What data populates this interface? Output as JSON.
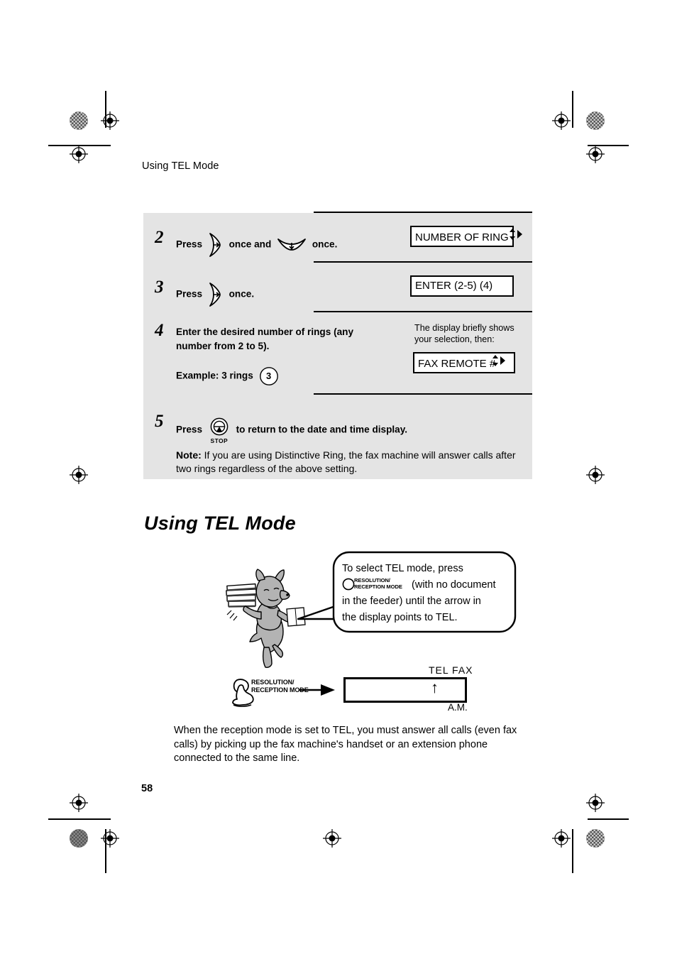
{
  "page": {
    "running_head": "Using TEL Mode",
    "folio": "58"
  },
  "procedure": {
    "steps": [
      {
        "number": "2",
        "text_before": "Press",
        "icon_1": "arrow-right-key-icon",
        "text_middle": "once and",
        "icon_2": "arrow-down-key-icon",
        "text_after": "once.",
        "lcd": {
          "text": "NUMBER OF RING",
          "indicator": "updown-right-arrows-icon"
        }
      },
      {
        "number": "3",
        "text_before": "Press",
        "icon_1": "arrow-right-key-icon",
        "text_after": "once.",
        "lcd": {
          "text": "ENTER (2-5) (4)",
          "indicator": ""
        }
      },
      {
        "number": "4",
        "instruction": "Enter the desired number of rings (any number from 2 to 5).",
        "example_label": "Example: 3 rings",
        "example_key": "3",
        "side_note": "The display briefly shows your selection, then:",
        "lcd": {
          "text": "FAX REMOTE #",
          "indicator": "updown-right-arrows-icon"
        }
      },
      {
        "number": "5",
        "text_before": "Press",
        "icon_1": "stop-button-icon",
        "stop_label": "STOP",
        "text_after": "to return to the date and time display."
      }
    ],
    "note_label": "Note:",
    "note_text": " If you are using Distinctive Ring, the fax machine will answer calls after two rings regardless of the above setting."
  },
  "section": {
    "heading": "Using TEL Mode",
    "bubble": {
      "line1": "To select TEL mode, press",
      "button_line1": "RESOLUTION/",
      "button_line2": "RECEPTION MODE",
      "line2_after_button": "(with no document",
      "line3": "in the feeder) until the arrow in",
      "line4": "the display points to TEL."
    },
    "diagram": {
      "button_line1": "RESOLUTION/",
      "button_line2": "RECEPTION MODE",
      "arrow": "arrow-right-icon",
      "display_top_label": "TEL  FAX",
      "display_indicator": "↑",
      "display_bottom_label": "A.M."
    },
    "closing_paragraph": "When the reception mode is set to TEL, you must answer all calls (even fax calls) by picking up the fax machine's handset or an extension phone connected to the same line."
  },
  "colors": {
    "panel_bg": "#e4e4e4",
    "ink": "#000000",
    "mascot_fill": "#b3b3b3",
    "reg_mark": "#6b6b6b"
  }
}
